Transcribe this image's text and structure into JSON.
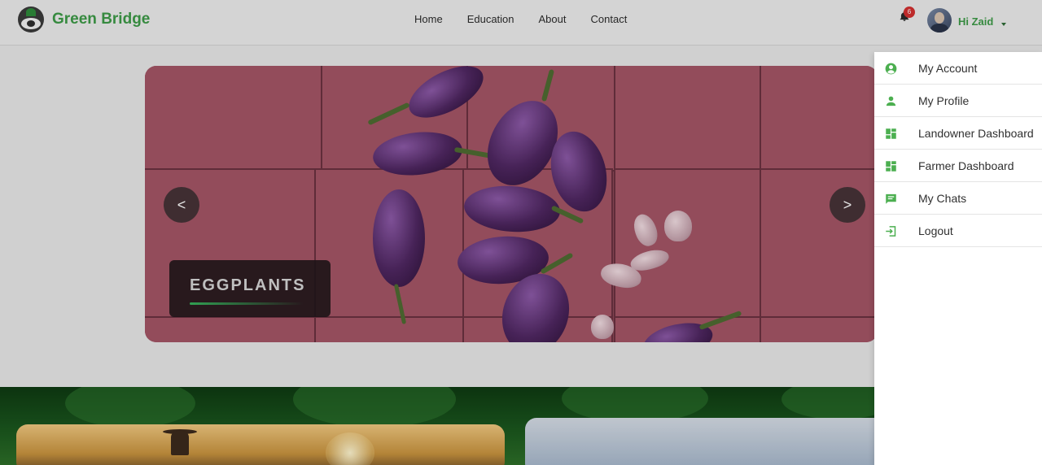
{
  "brand": {
    "name": "Green Bridge"
  },
  "nav": {
    "links": [
      "Home",
      "Education",
      "About",
      "Contact"
    ]
  },
  "user": {
    "notification_count": "6",
    "greeting": "Hi Zaid"
  },
  "carousel": {
    "caption": "EGGPLANTS",
    "prev_label": "<",
    "next_label": ">"
  },
  "dropdown": {
    "items": [
      {
        "label": "My Account",
        "icon": "account-circle-icon"
      },
      {
        "label": "My Profile",
        "icon": "person-icon"
      },
      {
        "label": "Landowner Dashboard",
        "icon": "dashboard-icon"
      },
      {
        "label": "Farmer Dashboard",
        "icon": "dashboard-icon"
      },
      {
        "label": "My Chats",
        "icon": "chat-icon"
      },
      {
        "label": "Logout",
        "icon": "logout-icon"
      }
    ]
  },
  "colors": {
    "brand_green": "#3d9a47",
    "icon_green": "#4caf50",
    "badge_red": "#d32f2f"
  }
}
